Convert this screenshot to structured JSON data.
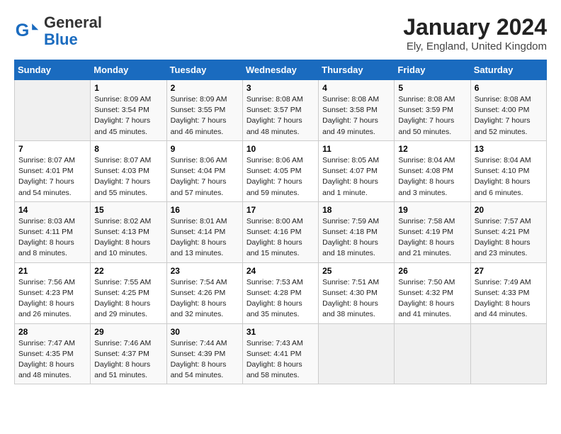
{
  "logo": {
    "general": "General",
    "blue": "Blue"
  },
  "header": {
    "month": "January 2024",
    "location": "Ely, England, United Kingdom"
  },
  "weekdays": [
    "Sunday",
    "Monday",
    "Tuesday",
    "Wednesday",
    "Thursday",
    "Friday",
    "Saturday"
  ],
  "weeks": [
    [
      {
        "day": "",
        "empty": true
      },
      {
        "day": "1",
        "sunrise": "Sunrise: 8:09 AM",
        "sunset": "Sunset: 3:54 PM",
        "daylight": "Daylight: 7 hours and 45 minutes."
      },
      {
        "day": "2",
        "sunrise": "Sunrise: 8:09 AM",
        "sunset": "Sunset: 3:55 PM",
        "daylight": "Daylight: 7 hours and 46 minutes."
      },
      {
        "day": "3",
        "sunrise": "Sunrise: 8:08 AM",
        "sunset": "Sunset: 3:57 PM",
        "daylight": "Daylight: 7 hours and 48 minutes."
      },
      {
        "day": "4",
        "sunrise": "Sunrise: 8:08 AM",
        "sunset": "Sunset: 3:58 PM",
        "daylight": "Daylight: 7 hours and 49 minutes."
      },
      {
        "day": "5",
        "sunrise": "Sunrise: 8:08 AM",
        "sunset": "Sunset: 3:59 PM",
        "daylight": "Daylight: 7 hours and 50 minutes."
      },
      {
        "day": "6",
        "sunrise": "Sunrise: 8:08 AM",
        "sunset": "Sunset: 4:00 PM",
        "daylight": "Daylight: 7 hours and 52 minutes."
      }
    ],
    [
      {
        "day": "7",
        "sunrise": "Sunrise: 8:07 AM",
        "sunset": "Sunset: 4:01 PM",
        "daylight": "Daylight: 7 hours and 54 minutes."
      },
      {
        "day": "8",
        "sunrise": "Sunrise: 8:07 AM",
        "sunset": "Sunset: 4:03 PM",
        "daylight": "Daylight: 7 hours and 55 minutes."
      },
      {
        "day": "9",
        "sunrise": "Sunrise: 8:06 AM",
        "sunset": "Sunset: 4:04 PM",
        "daylight": "Daylight: 7 hours and 57 minutes."
      },
      {
        "day": "10",
        "sunrise": "Sunrise: 8:06 AM",
        "sunset": "Sunset: 4:05 PM",
        "daylight": "Daylight: 7 hours and 59 minutes."
      },
      {
        "day": "11",
        "sunrise": "Sunrise: 8:05 AM",
        "sunset": "Sunset: 4:07 PM",
        "daylight": "Daylight: 8 hours and 1 minute."
      },
      {
        "day": "12",
        "sunrise": "Sunrise: 8:04 AM",
        "sunset": "Sunset: 4:08 PM",
        "daylight": "Daylight: 8 hours and 3 minutes."
      },
      {
        "day": "13",
        "sunrise": "Sunrise: 8:04 AM",
        "sunset": "Sunset: 4:10 PM",
        "daylight": "Daylight: 8 hours and 6 minutes."
      }
    ],
    [
      {
        "day": "14",
        "sunrise": "Sunrise: 8:03 AM",
        "sunset": "Sunset: 4:11 PM",
        "daylight": "Daylight: 8 hours and 8 minutes."
      },
      {
        "day": "15",
        "sunrise": "Sunrise: 8:02 AM",
        "sunset": "Sunset: 4:13 PM",
        "daylight": "Daylight: 8 hours and 10 minutes."
      },
      {
        "day": "16",
        "sunrise": "Sunrise: 8:01 AM",
        "sunset": "Sunset: 4:14 PM",
        "daylight": "Daylight: 8 hours and 13 minutes."
      },
      {
        "day": "17",
        "sunrise": "Sunrise: 8:00 AM",
        "sunset": "Sunset: 4:16 PM",
        "daylight": "Daylight: 8 hours and 15 minutes."
      },
      {
        "day": "18",
        "sunrise": "Sunrise: 7:59 AM",
        "sunset": "Sunset: 4:18 PM",
        "daylight": "Daylight: 8 hours and 18 minutes."
      },
      {
        "day": "19",
        "sunrise": "Sunrise: 7:58 AM",
        "sunset": "Sunset: 4:19 PM",
        "daylight": "Daylight: 8 hours and 21 minutes."
      },
      {
        "day": "20",
        "sunrise": "Sunrise: 7:57 AM",
        "sunset": "Sunset: 4:21 PM",
        "daylight": "Daylight: 8 hours and 23 minutes."
      }
    ],
    [
      {
        "day": "21",
        "sunrise": "Sunrise: 7:56 AM",
        "sunset": "Sunset: 4:23 PM",
        "daylight": "Daylight: 8 hours and 26 minutes."
      },
      {
        "day": "22",
        "sunrise": "Sunrise: 7:55 AM",
        "sunset": "Sunset: 4:25 PM",
        "daylight": "Daylight: 8 hours and 29 minutes."
      },
      {
        "day": "23",
        "sunrise": "Sunrise: 7:54 AM",
        "sunset": "Sunset: 4:26 PM",
        "daylight": "Daylight: 8 hours and 32 minutes."
      },
      {
        "day": "24",
        "sunrise": "Sunrise: 7:53 AM",
        "sunset": "Sunset: 4:28 PM",
        "daylight": "Daylight: 8 hours and 35 minutes."
      },
      {
        "day": "25",
        "sunrise": "Sunrise: 7:51 AM",
        "sunset": "Sunset: 4:30 PM",
        "daylight": "Daylight: 8 hours and 38 minutes."
      },
      {
        "day": "26",
        "sunrise": "Sunrise: 7:50 AM",
        "sunset": "Sunset: 4:32 PM",
        "daylight": "Daylight: 8 hours and 41 minutes."
      },
      {
        "day": "27",
        "sunrise": "Sunrise: 7:49 AM",
        "sunset": "Sunset: 4:33 PM",
        "daylight": "Daylight: 8 hours and 44 minutes."
      }
    ],
    [
      {
        "day": "28",
        "sunrise": "Sunrise: 7:47 AM",
        "sunset": "Sunset: 4:35 PM",
        "daylight": "Daylight: 8 hours and 48 minutes."
      },
      {
        "day": "29",
        "sunrise": "Sunrise: 7:46 AM",
        "sunset": "Sunset: 4:37 PM",
        "daylight": "Daylight: 8 hours and 51 minutes."
      },
      {
        "day": "30",
        "sunrise": "Sunrise: 7:44 AM",
        "sunset": "Sunset: 4:39 PM",
        "daylight": "Daylight: 8 hours and 54 minutes."
      },
      {
        "day": "31",
        "sunrise": "Sunrise: 7:43 AM",
        "sunset": "Sunset: 4:41 PM",
        "daylight": "Daylight: 8 hours and 58 minutes."
      },
      {
        "day": "",
        "empty": true
      },
      {
        "day": "",
        "empty": true
      },
      {
        "day": "",
        "empty": true
      }
    ]
  ]
}
